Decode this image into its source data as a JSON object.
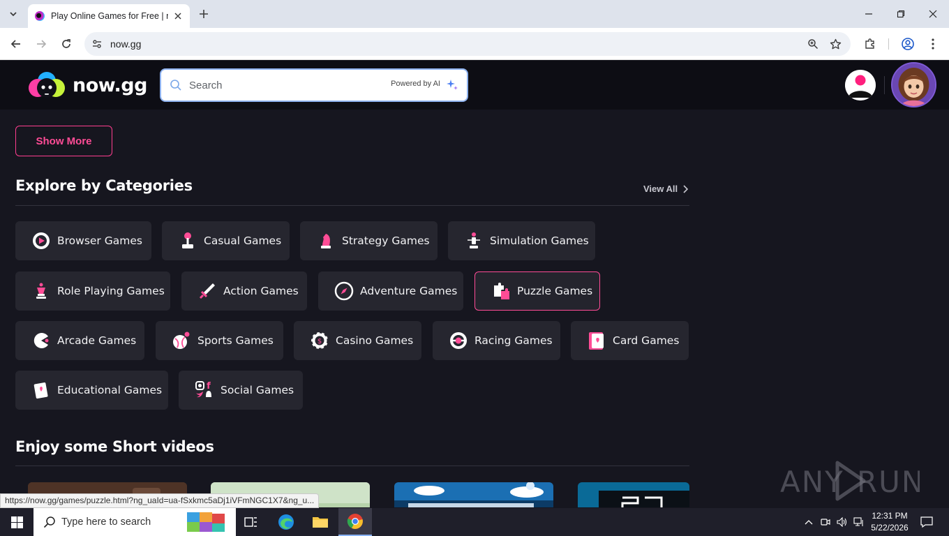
{
  "browser": {
    "tab_title": "Play Online Games for Free | now.gg",
    "url": "now.gg",
    "status_url": "https://now.gg/games/puzzle.html?ng_uaId=ua-fSxkmc5aDj1iVFmNGC1X7&ng_u..."
  },
  "header": {
    "logo_text": "now.gg",
    "search_placeholder": "Search",
    "powered_by": "Powered by AI"
  },
  "content": {
    "show_more_label": "Show More",
    "categories_title": "Explore by Categories",
    "view_all_label": "View All",
    "categories": [
      {
        "label": "Browser Games",
        "icon": "browser-games-icon"
      },
      {
        "label": "Casual Games",
        "icon": "joystick-icon"
      },
      {
        "label": "Strategy Games",
        "icon": "chess-knight-icon"
      },
      {
        "label": "Simulation Games",
        "icon": "simulation-icon"
      },
      {
        "label": "Role Playing Games",
        "icon": "chess-queen-icon"
      },
      {
        "label": "Action Games",
        "icon": "sword-icon"
      },
      {
        "label": "Adventure Games",
        "icon": "compass-icon"
      },
      {
        "label": "Puzzle Games",
        "icon": "puzzle-icon",
        "selected": true
      },
      {
        "label": "Arcade Games",
        "icon": "pacman-icon"
      },
      {
        "label": "Sports Games",
        "icon": "baseball-icon"
      },
      {
        "label": "Casino Games",
        "icon": "casino-chip-icon"
      },
      {
        "label": "Racing Games",
        "icon": "racing-wheel-icon"
      },
      {
        "label": "Card Games",
        "icon": "playing-card-icon"
      },
      {
        "label": "Educational Games",
        "icon": "educational-icon"
      },
      {
        "label": "Social Games",
        "icon": "social-icon"
      }
    ],
    "videos_title": "Enjoy some Short videos"
  },
  "watermark": "ANY RUN",
  "taskbar": {
    "search_placeholder": "Type here to search",
    "time": "12:31 PM",
    "date": "5/22/2026"
  },
  "colors": {
    "accent": "#ff4c96",
    "page_bg": "#16161f",
    "chip_bg": "#26262f"
  }
}
